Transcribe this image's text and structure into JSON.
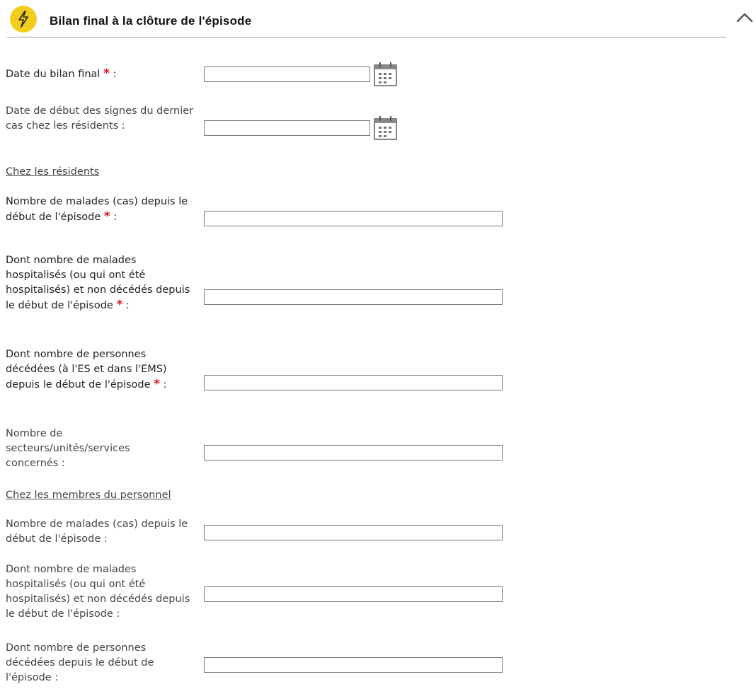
{
  "section": {
    "title": "Bilan final à la clôture de l'épisode",
    "badge_icon": "lightning-icon",
    "collapse_icon": "chevron-up-icon",
    "badge_color": "#f3cd1c",
    "required_color": "#e0141e"
  },
  "fields": {
    "date_bilan": {
      "label": "Date du bilan final",
      "suffix": " :",
      "value": ""
    },
    "date_debut_signes": {
      "label": "Date de début des signes du dernier cas chez les résidents :",
      "value": ""
    },
    "residents_heading": "Chez les résidents",
    "res_malades": {
      "label": "Nombre de malades (cas) depuis le début de l'épisode",
      "suffix": " :",
      "value": ""
    },
    "res_hospitalises": {
      "label": "Dont nombre de malades hospitalisés (ou qui ont été hospitalisés) et non décédés depuis le début de l'épisode",
      "suffix": " :",
      "value": ""
    },
    "res_decedes": {
      "label": "Dont nombre de personnes décédées (à l'ES et dans l'EMS) depuis le début de l'épisode",
      "suffix": " :",
      "value": ""
    },
    "res_secteurs": {
      "label": "Nombre de secteurs/unités/services concernés :",
      "value": ""
    },
    "personnel_heading": "Chez les membres du personnel",
    "pers_malades": {
      "label": "Nombre de malades (cas) depuis le début de l'épisode :",
      "value": ""
    },
    "pers_hospitalises": {
      "label": "Dont nombre de malades hospitalisés (ou qui ont été hospitalisés) et non décédés depuis le début de l'épisode :",
      "value": ""
    },
    "pers_decedes": {
      "label": "Dont nombre de personnes décédées depuis le début de l'épisode :",
      "value": ""
    }
  },
  "required_marker": "*",
  "calendar_icon": "calendar-icon"
}
